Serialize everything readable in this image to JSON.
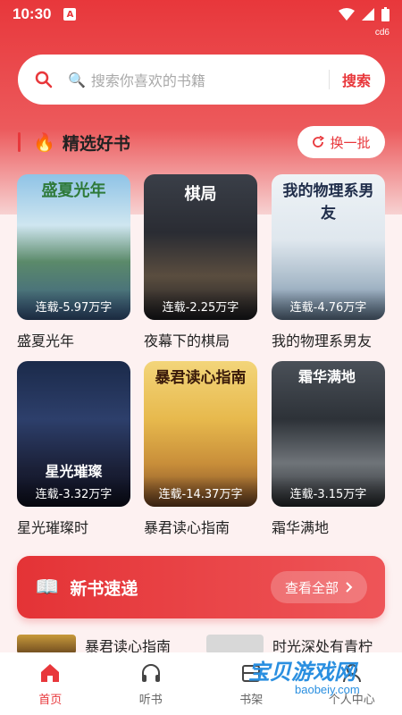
{
  "status": {
    "time": "10:30",
    "badge": "A",
    "build": "cd6"
  },
  "search": {
    "placeholder": "搜索你喜欢的书籍",
    "button": "搜索"
  },
  "featured": {
    "title": "精选好书",
    "refresh": "换一批"
  },
  "books": [
    {
      "name": "盛夏光年",
      "tag": "连载-5.97万字",
      "cover_title": "盛夏光年"
    },
    {
      "name": "夜幕下的棋局",
      "tag": "连载-2.25万字",
      "cover_title": "棋局"
    },
    {
      "name": "我的物理系男友",
      "tag": "连载-4.76万字",
      "cover_title": "我的物理系男友"
    },
    {
      "name": "星光璀璨时",
      "tag": "连载-3.32万字",
      "cover_title": "星光璀璨"
    },
    {
      "name": "暴君读心指南",
      "tag": "连载-14.37万字",
      "cover_title": "暴君读心指南"
    },
    {
      "name": "霜华满地",
      "tag": "连载-3.15万字",
      "cover_title": "霜华满地"
    }
  ],
  "new_books": {
    "title": "新书速递",
    "view_all": "查看全部",
    "items": [
      "暴君读心指南",
      "时光深处有青柠"
    ]
  },
  "tabs": [
    {
      "label": "首页",
      "icon": "home-icon",
      "active": true
    },
    {
      "label": "听书",
      "icon": "headphones-icon",
      "active": false
    },
    {
      "label": "书架",
      "icon": "bookshelf-icon",
      "active": false
    },
    {
      "label": "个人中心",
      "icon": "user-icon",
      "active": false
    }
  ],
  "watermark": {
    "text": "宝贝游戏网",
    "url": "baobeiy.com"
  },
  "colors": {
    "accent": "#e8373b"
  }
}
